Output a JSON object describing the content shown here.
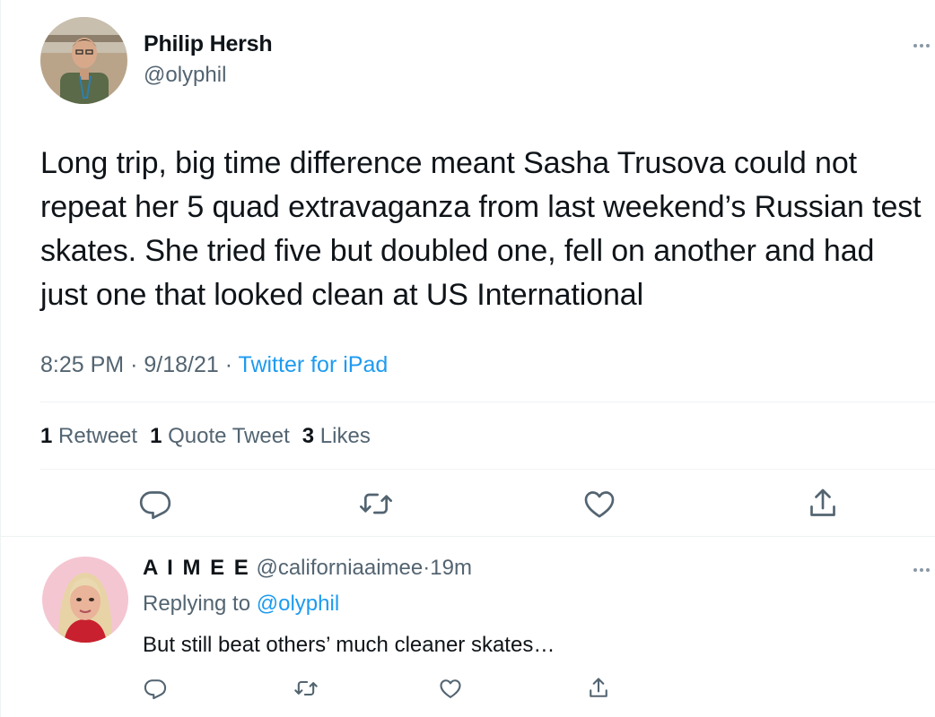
{
  "tweet": {
    "author_name": "Philip Hersh",
    "author_handle": "@olyphil",
    "text": "Long trip, big time difference meant Sasha Trusova could not repeat her 5 quad extravaganza from last weekend’s Russian test skates.  She tried five but doubled one, fell on another and had just one that looked clean at US International",
    "time": "8:25 PM",
    "date": "9/18/21",
    "separator": "·",
    "source": "Twitter for iPad",
    "stats": {
      "retweets_count": "1",
      "retweets_label": "Retweet",
      "quotes_count": "1",
      "quotes_label": "Quote Tweet",
      "likes_count": "3",
      "likes_label": "Likes"
    },
    "actions": [
      "reply-icon",
      "retweet-icon",
      "like-icon",
      "share-icon"
    ]
  },
  "reply": {
    "author_name": "A I M E E",
    "author_handle": "@californiaaimee",
    "separator": "·",
    "time": "19m",
    "replying_prefix": "Replying to",
    "replying_to": "@olyphil",
    "text": "But still beat others’ much cleaner skates…",
    "actions": [
      "reply-icon",
      "retweet-icon",
      "like-icon",
      "share-icon"
    ]
  },
  "colors": {
    "accent": "#1d9bf0",
    "secondary_text": "#536471",
    "primary_text": "#0f1419",
    "divider": "#eff3f4"
  }
}
